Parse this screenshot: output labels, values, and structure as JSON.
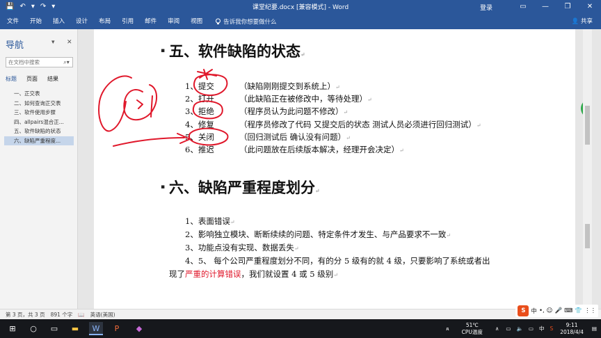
{
  "title_bar": {
    "quick_access": [
      "💾",
      "↶",
      "▾",
      "↷",
      "▾"
    ],
    "window_title": "课堂纪要.docx [兼容模式] - Word",
    "login": "登录",
    "controls": [
      "▭",
      "—",
      "❐",
      "✕"
    ]
  },
  "ribbon": {
    "tabs": [
      "文件",
      "开始",
      "插入",
      "设计",
      "布局",
      "引用",
      "邮件",
      "审阅",
      "视图"
    ],
    "tell_me": "告诉我你想要做什么",
    "share": "共享"
  },
  "nav": {
    "title": "导航",
    "search_placeholder": "在文档中搜索",
    "tabs": [
      "标题",
      "页面",
      "结果"
    ],
    "items": [
      "一、正交表",
      "二、如何查询正交表",
      "三、软件使用步骤",
      "四、allpairs混合正...",
      "五、软件缺陷的状态",
      "六、缺陷严重程度..."
    ]
  },
  "document": {
    "heading5": "五、软件缺陷的状态",
    "states": [
      {
        "num": "1、",
        "name": "提交",
        "desc": "（缺陷刚刚提交到系统上）"
      },
      {
        "num": "2、",
        "name": "打开",
        "desc": "（此缺陷正在被修改中，等待处理）"
      },
      {
        "num": "3、",
        "name": "拒绝",
        "desc": "（程序员认为此问题不修改）"
      },
      {
        "num": "4、",
        "name": "修复",
        "desc": "（程序员修改了代码  又提交后的状态  测试人员必须进行回归测试）"
      },
      {
        "num": "5、",
        "name": "关闭",
        "desc": "（回归测试后  确认没有问题）"
      },
      {
        "num": "6、",
        "name": "推迟",
        "desc": "（此问题放在后续版本解决，经理开会决定）"
      }
    ],
    "heading6": "六、缺陷严重程度划分",
    "levels": [
      "1、表面错误",
      "2、影响独立模块、断断续续的问题、特定条件才发生、与产品要求不一致",
      "3、功能点没有实现、数据丢失"
    ],
    "level4_line1": "4、5、    每个公司严重程度划分不同，有的分 5 级有的就 4 级，只要影响了系统或者出",
    "level4_prefix": "现了",
    "level4_red": "严重的计算错误",
    "level4_suffix": "，我们就设置 4 或 5 级别"
  },
  "status_bar": {
    "page": "第 3 页，共 3 页",
    "words": "891 个字",
    "language": "英语(美国)"
  },
  "ime": {
    "logo": "S",
    "items": [
      "中",
      "•,",
      "☺",
      "🎤",
      "⌨",
      "👕",
      "⋮⋮"
    ]
  },
  "taskbar": {
    "weather_temp": "51℃",
    "weather_label": "CPU温度",
    "ime_lang": "中",
    "time": "9:11",
    "date": "2018/4/4"
  },
  "colors": {
    "word_blue": "#2b579a",
    "ink_red": "#e0182b"
  }
}
